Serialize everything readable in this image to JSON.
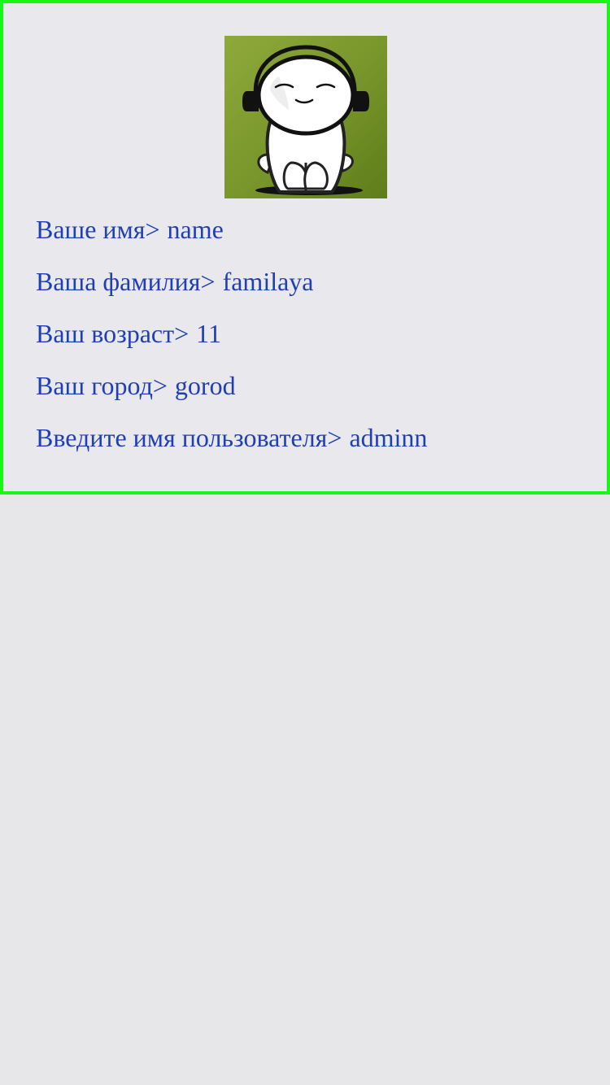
{
  "profile": {
    "avatar_icon": "avatar-cartoon-headphones",
    "colors": {
      "border": "#19f719",
      "text": "#1f3fb5",
      "background": "#e9e8ec",
      "avatar_background": "#6f8f23"
    },
    "separator": ">",
    "fields": [
      {
        "label": "Ваше имя",
        "value": "name"
      },
      {
        "label": "Ваша фамилия",
        "value": "familaya"
      },
      {
        "label": "Ваш возраст",
        "value": "11"
      },
      {
        "label": "Ваш город",
        "value": "gorod"
      },
      {
        "label": "Введите имя пользователя",
        "value": "adminn"
      }
    ]
  }
}
